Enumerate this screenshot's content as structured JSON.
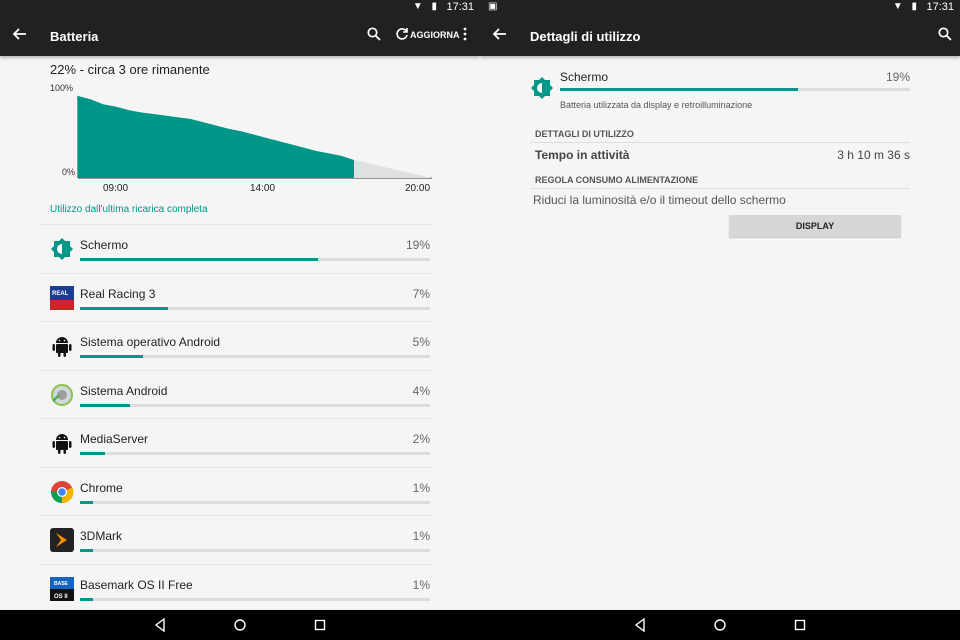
{
  "status": {
    "time_left": "17:31",
    "time_right": "17:31"
  },
  "left": {
    "title": "Batteria",
    "refresh_label": "AGGIORNA",
    "summary": "22% - circa 3 ore rimanente",
    "chart_data": {
      "type": "area",
      "y_labels": [
        "100%",
        "0%"
      ],
      "x_labels": [
        "09:00",
        "14:00",
        "20:00"
      ],
      "ylim": [
        0,
        100
      ],
      "series": [
        {
          "values": [
            100,
            96,
            90,
            87,
            83,
            80,
            78,
            76,
            74,
            72,
            68,
            64,
            60,
            57,
            53,
            49,
            45,
            41,
            37,
            33,
            30,
            27,
            22
          ]
        }
      ],
      "projection": {
        "from": 22,
        "to": 0
      },
      "colors": {
        "fill": "#009688",
        "projection": "#e0e0e0"
      }
    },
    "section_caption": "Utilizzo dall'ultima ricarica completa",
    "items": [
      {
        "name": "Schermo",
        "percent": "19%",
        "level": 19
      },
      {
        "name": "Real Racing 3",
        "percent": "7%",
        "level": 7
      },
      {
        "name": "Sistema operativo Android",
        "percent": "5%",
        "level": 5
      },
      {
        "name": "Sistema Android",
        "percent": "4%",
        "level": 4
      },
      {
        "name": "MediaServer",
        "percent": "2%",
        "level": 2
      },
      {
        "name": "Chrome",
        "percent": "1%",
        "level": 1
      },
      {
        "name": "3DMark",
        "percent": "1%",
        "level": 1
      },
      {
        "name": "Basemark OS II Free",
        "percent": "1%",
        "level": 1
      }
    ],
    "icon_badges": {
      "basemark": "OS II",
      "basemark_top": "BASE",
      "racing": "REAL"
    }
  },
  "right": {
    "title": "Dettagli di utilizzo",
    "app": {
      "name": "Schermo",
      "percent": "19%",
      "level": 19,
      "description": "Batteria utilizzata da display e retroilluminazione"
    },
    "usage_header": "DETTAGLI DI UTILIZZO",
    "usage_label": "Tempo in attività",
    "usage_value": "3 h 10 m 36 s",
    "power_header": "REGOLA CONSUMO ALIMENTAZIONE",
    "tip": "Riduci la luminosità e/o il timeout dello schermo",
    "button_label": "DISPLAY"
  },
  "colors": {
    "accent": "#009688",
    "appbar": "#212121",
    "statusbar": "#222222"
  }
}
